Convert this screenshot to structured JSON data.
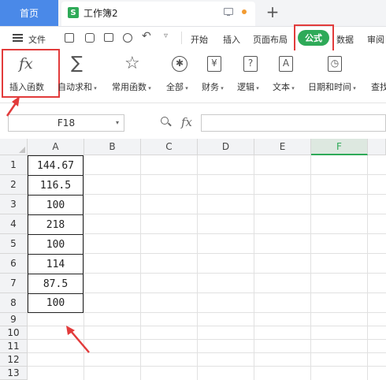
{
  "titlebar": {
    "home_tab": "首页",
    "doc_icon": "S",
    "doc_name": "工作簿2",
    "new_tab": "+"
  },
  "menubar": {
    "file": "文件",
    "items": [
      "开始",
      "插入",
      "页面布局",
      "公式",
      "数据",
      "审阅"
    ],
    "active": "公式"
  },
  "ribbon": {
    "buttons": [
      {
        "label": "插入函数",
        "icon": "fx"
      },
      {
        "label": "自动求和",
        "icon": "∑"
      },
      {
        "label": "常用函数",
        "icon": "☆"
      },
      {
        "label": "全部",
        "icon": "✱"
      },
      {
        "label": "财务",
        "icon": "¥"
      },
      {
        "label": "逻辑",
        "icon": "?"
      },
      {
        "label": "文本",
        "icon": "A"
      },
      {
        "label": "日期和时间",
        "icon": "◷"
      },
      {
        "label": "查找",
        "icon": ""
      }
    ]
  },
  "formula_bar": {
    "cell_ref": "F18",
    "fx": "fx",
    "value": ""
  },
  "sheet": {
    "columns": [
      "A",
      "B",
      "C",
      "D",
      "E",
      "F"
    ],
    "selected_column": "F",
    "rows": [
      "1",
      "2",
      "3",
      "4",
      "5",
      "6",
      "7",
      "8",
      "9",
      "10",
      "11",
      "12",
      "13"
    ],
    "a_values": [
      "144.67",
      "116.5",
      "100",
      "218",
      "100",
      "114",
      "87.5",
      "100"
    ]
  },
  "colors": {
    "accent_green": "#2eaa58",
    "home_tab_blue": "#4a89e8",
    "annotation_red": "#e23b3b"
  },
  "icons": [
    "menu-icon",
    "save-icon",
    "print-icon",
    "undo-icon",
    "search-icon",
    "fx-icon"
  ]
}
